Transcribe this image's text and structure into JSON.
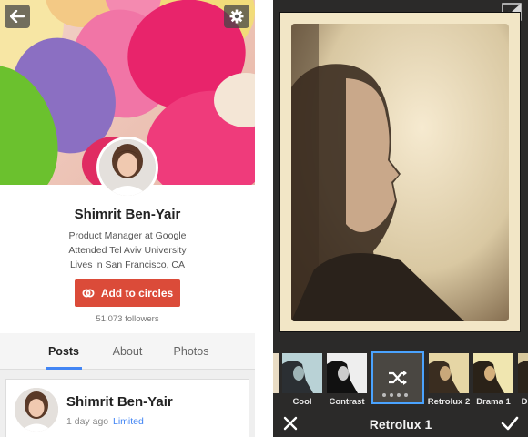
{
  "profile": {
    "name": "Shimrit Ben-Yair",
    "job": "Product Manager at Google",
    "education": "Attended Tel Aviv University",
    "location": "Lives in San Francisco, CA",
    "add_button": "Add to circles",
    "followers": "51,073 followers"
  },
  "tabs": [
    {
      "label": "Posts",
      "active": true
    },
    {
      "label": "About",
      "active": false
    },
    {
      "label": "Photos",
      "active": false
    }
  ],
  "post": {
    "author": "Shimrit Ben-Yair",
    "time": "1 day ago",
    "visibility": "Limited"
  },
  "editor": {
    "current_filter": "Retrolux 1",
    "filters": [
      {
        "label": "Cool"
      },
      {
        "label": "Contrast"
      },
      {
        "label": "",
        "selected": true
      },
      {
        "label": "Retrolux 2"
      },
      {
        "label": "Drama 1"
      },
      {
        "label": "D"
      }
    ]
  },
  "icons": {
    "back": "back-arrow-icon",
    "settings": "gear-icon",
    "circles": "circles-link-icon",
    "shuffle": "shuffle-icon",
    "compare": "compare-icon",
    "cancel": "close-icon",
    "confirm": "checkmark-icon"
  },
  "colors": {
    "accent_red": "#db4b39",
    "link_blue": "#4285f4",
    "selection_blue": "#4aa3ff",
    "editor_bg": "#2b2a29"
  }
}
